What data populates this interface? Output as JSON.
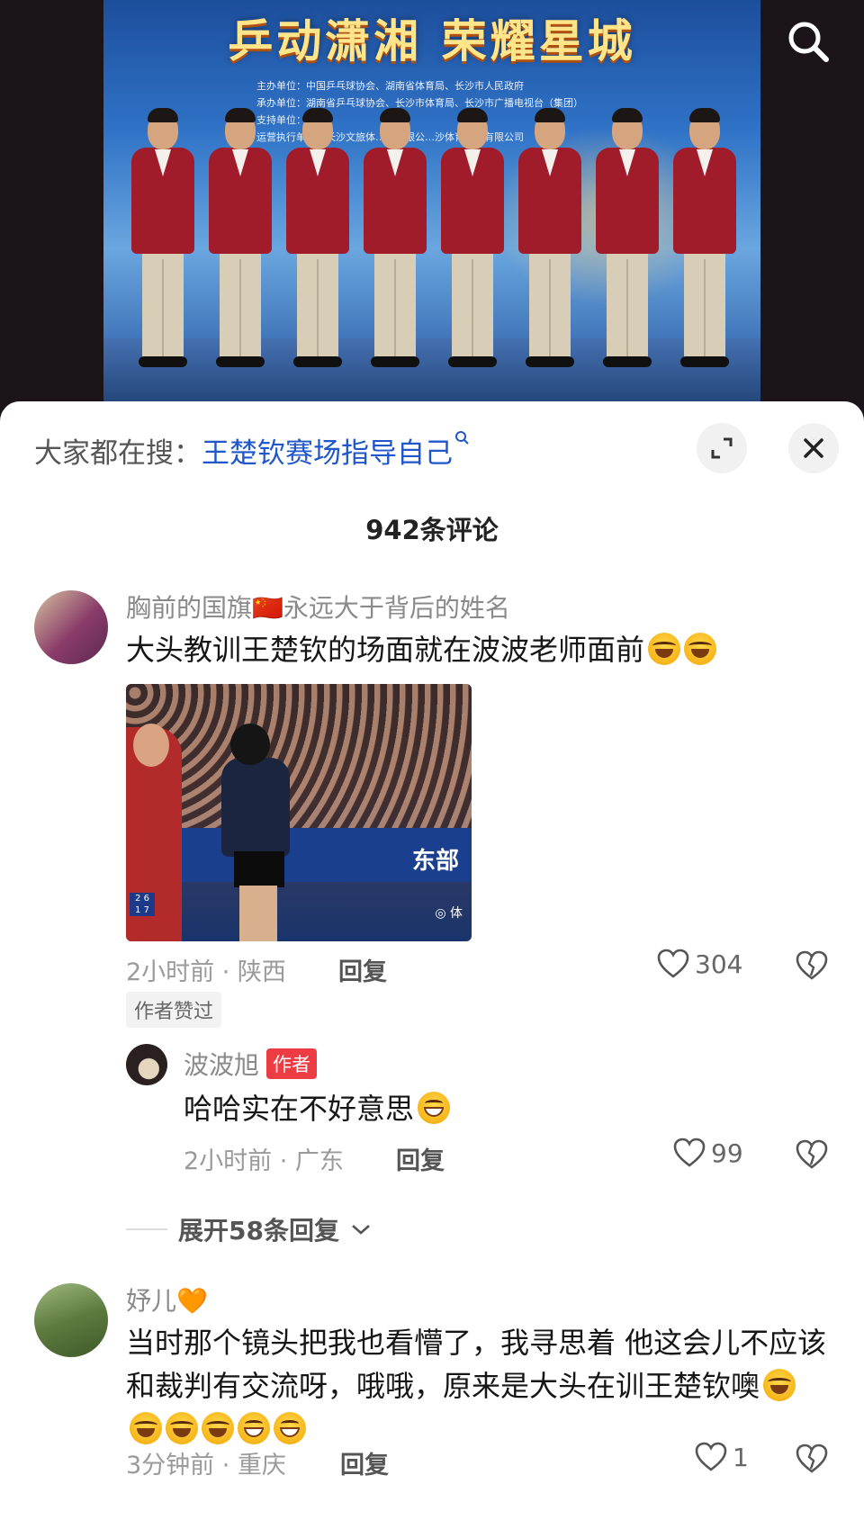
{
  "video": {
    "banner_title": "乒动潇湘 荣耀星城",
    "sponsors": [
      "主办单位：中国乒乓球协会、湖南省体育局、长沙市人民政府",
      "承办单位：湖南省乒乓球协会、长沙市体育局、长沙市广播电视台（集团）",
      "支持单位：…学",
      "运营执行单位：长沙文旅体…育有限公…沙体育产…有限公司"
    ]
  },
  "header": {
    "search_prefix": "大家都在搜：",
    "search_keyword": "王楚钦赛场指导自己",
    "comment_count": "942条评论"
  },
  "comments": [
    {
      "username": "胸前的国旗🇨🇳永远大于背后的姓名",
      "text": "大头教训王楚钦的场面就在波波老师面前",
      "image_caption": "东部",
      "meta": "2小时前 · 陕西",
      "reply_label": "回复",
      "likes": "304",
      "author_liked": "作者赞过",
      "replies": [
        {
          "username": "波波旭",
          "badge": "作者",
          "text": "哈哈实在不好意思",
          "meta": "2小时前 · 广东",
          "reply_label": "回复",
          "likes": "99"
        }
      ],
      "expand_label": "展开58条回复"
    },
    {
      "username": "妤儿🧡",
      "text": "当时那个镜头把我也看懵了，我寻思着  他这会儿不应该和裁判有交流呀，哦哦，原来是大头在训王楚钦噢",
      "meta": "3分钟前 · 重庆",
      "reply_label": "回复",
      "likes": "1"
    }
  ],
  "icons": [
    "search-icon",
    "expand-icon",
    "close-icon",
    "heart-icon",
    "broken-heart-icon",
    "chevron-down-icon",
    "search-keyword-icon"
  ]
}
